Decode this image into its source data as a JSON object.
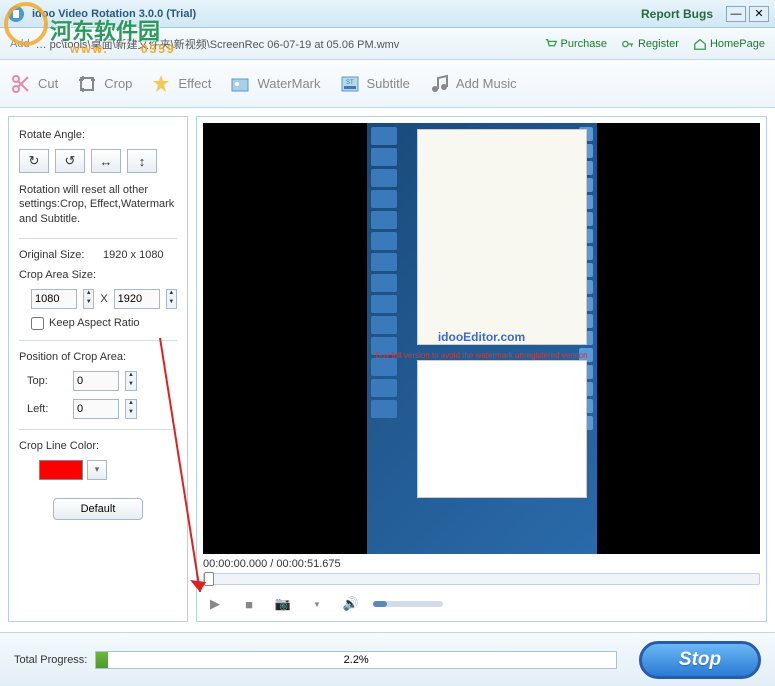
{
  "window": {
    "title": "idoo Video Rotation 3.0.0 (Trial)",
    "report_bugs": "Report Bugs"
  },
  "path": {
    "prefix": "Add",
    "value": "… pc\\tools\\桌面\\新建文件夹\\新视频\\ScreenRec 06-07-19 at 05.06 PM.wmv"
  },
  "links": {
    "purchase": "Purchase",
    "register": "Register",
    "homepage": "HomePage"
  },
  "toolbar": {
    "cut": "Cut",
    "crop": "Crop",
    "effect": "Effect",
    "watermark": "WaterMark",
    "subtitle": "Subtitle",
    "add_music": "Add Music"
  },
  "side": {
    "rotate_angle": "Rotate Angle:",
    "note": "Rotation will reset all other settings:Crop, Effect,Watermark and Subtitle.",
    "original_size_label": "Original Size:",
    "original_size_value": "1920 x 1080",
    "crop_area_size": "Crop Area Size:",
    "crop_w": "1080",
    "crop_h": "1920",
    "x": "X",
    "keep_ratio": "Keep Aspect Ratio",
    "position_label": "Position of Crop Area:",
    "top_label": "Top:",
    "top_value": "0",
    "left_label": "Left:",
    "left_value": "0",
    "crop_line_color": "Crop Line Color:",
    "crop_color": "#ff0000",
    "default": "Default"
  },
  "preview": {
    "watermark_text": "idooEditor.com",
    "watermark_sub": "Buy full version to avoid the watermark unregistered version",
    "time": "00:00:00.000 / 00:00:51.675"
  },
  "footer": {
    "progress_label": "Total Progress:",
    "progress_percent": "2.2%",
    "progress_value": 2.2,
    "stop": "Stop"
  },
  "overlay": {
    "site": "河东软件园",
    "code": "0359"
  }
}
